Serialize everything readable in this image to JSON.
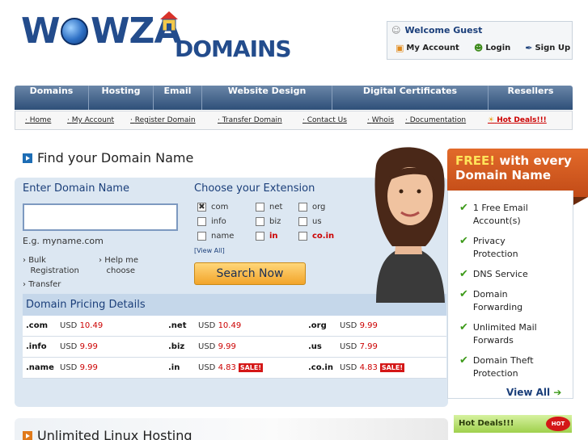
{
  "brand": {
    "logo_text": "WOWZA DOMAINS"
  },
  "welcome": {
    "title": "Welcome Guest",
    "my_account": "My Account",
    "login": "Login",
    "signup": "Sign Up"
  },
  "nav": {
    "items": [
      "Domains",
      "Hosting",
      "Email",
      "Website Design",
      "Digital Certificates",
      "Resellers"
    ]
  },
  "subnav": {
    "items": [
      "Home",
      "My Account",
      "Register Domain",
      "Transfer Domain",
      "Contact Us",
      "Whois",
      "Documentation",
      "Hot Deals!!!"
    ]
  },
  "finder": {
    "title": "Find your Domain Name",
    "enter_label": "Enter Domain Name",
    "input_value": "",
    "example": "E.g. myname.com",
    "links": {
      "bulk_line1": "Bulk",
      "bulk_line2": "Registration",
      "help_line1": "Help me",
      "help_line2": "choose",
      "transfer": "Transfer"
    },
    "ext_label": "Choose your Extension",
    "extensions": [
      {
        "name": "com",
        "checked": true
      },
      {
        "name": "net",
        "checked": false
      },
      {
        "name": "org",
        "checked": false
      },
      {
        "name": "info",
        "checked": false
      },
      {
        "name": "biz",
        "checked": false
      },
      {
        "name": "us",
        "checked": false
      },
      {
        "name": "name",
        "checked": false
      },
      {
        "name": "in",
        "checked": false
      },
      {
        "name": "co.in",
        "checked": false
      }
    ],
    "view_all": "[View All]",
    "search_button": "Search Now"
  },
  "pricing": {
    "title": "Domain Pricing Details",
    "currency": "USD",
    "sale_label": "SALE!",
    "rows": [
      [
        {
          "tld": ".com",
          "price": "10.49"
        },
        {
          "tld": ".net",
          "price": "10.49"
        },
        {
          "tld": ".org",
          "price": "9.99"
        }
      ],
      [
        {
          "tld": ".info",
          "price": "9.99"
        },
        {
          "tld": ".biz",
          "price": "9.99"
        },
        {
          "tld": ".us",
          "price": "7.99"
        }
      ],
      [
        {
          "tld": ".name",
          "price": "9.99"
        },
        {
          "tld": ".in",
          "price": "4.83",
          "sale": true
        },
        {
          "tld": ".co.in",
          "price": "4.83",
          "sale": true
        }
      ]
    ]
  },
  "promo": {
    "free": "FREE!",
    "with_every": "with every",
    "domain_name": "Domain Name"
  },
  "features": {
    "items": [
      [
        "1 Free Email",
        "Account(s)"
      ],
      [
        "Privacy",
        "Protection"
      ],
      [
        "DNS Service"
      ],
      [
        "Domain",
        "Forwarding"
      ],
      [
        "Unlimited Mail",
        "Forwards"
      ],
      [
        "Domain Theft",
        "Protection"
      ]
    ],
    "view_all": "View All"
  },
  "hosting": {
    "title": "Unlimited Linux Hosting"
  },
  "hot_deals": {
    "title": "Hot Deals!!!",
    "badge": "HOT"
  }
}
